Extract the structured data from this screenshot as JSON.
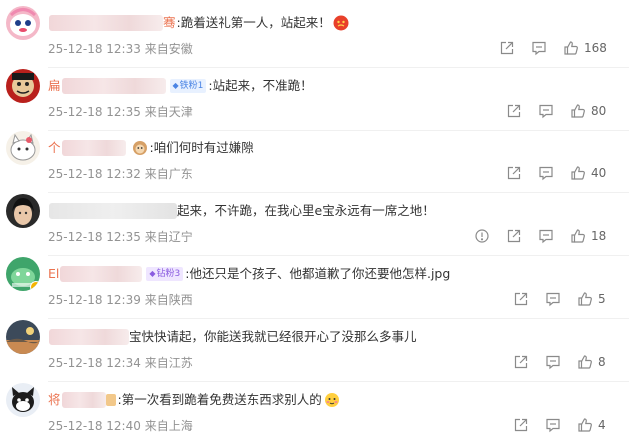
{
  "comments": [
    {
      "nick_visible": "",
      "nick_tail": "骞",
      "text": ":跪着送礼第一人，站起来！",
      "time": "25-12-18 12:33",
      "location": "来自安徽",
      "likes": "168",
      "emoji": "red-face-emoji-icon"
    },
    {
      "nick_visible": "扁",
      "badge": "铁粉1",
      "text": ":站起来，不准跪！",
      "time": "25-12-18 12:35",
      "location": "来自天津",
      "likes": "80"
    },
    {
      "nick_visible": "个",
      "text": ":咱们何时有过嫌隙",
      "time": "25-12-18 12:32",
      "location": "来自广东",
      "likes": "40"
    },
    {
      "nick_visible": "",
      "text": "起来，不许跪，在我心里e宝永远有一席之地！",
      "time": "25-12-18 12:35",
      "location": "来自辽宁",
      "likes": "18"
    },
    {
      "nick_visible": "El",
      "badge": "钻粉3",
      "text": ":他还只是个孩子、他都道歉了你还要他怎样.jpg",
      "time": "25-12-18 12:39",
      "location": "来自陕西",
      "likes": "5"
    },
    {
      "nick_visible": "",
      "text": "宝快快请起，你能送我就已经很开心了没那么多事儿",
      "time": "25-12-18 12:34",
      "location": "来自江苏",
      "likes": "8"
    },
    {
      "nick_visible": "将",
      "text": ":第一次看到跪着免费送东西求别人的",
      "time": "25-12-18 12:40",
      "location": "来自上海",
      "likes": "4",
      "emoji": "blushing-emoji-icon"
    }
  ],
  "colors": {
    "nick": "#eb7350",
    "meta": "#939393",
    "text": "#333333",
    "icon": "#8a8a8a"
  }
}
